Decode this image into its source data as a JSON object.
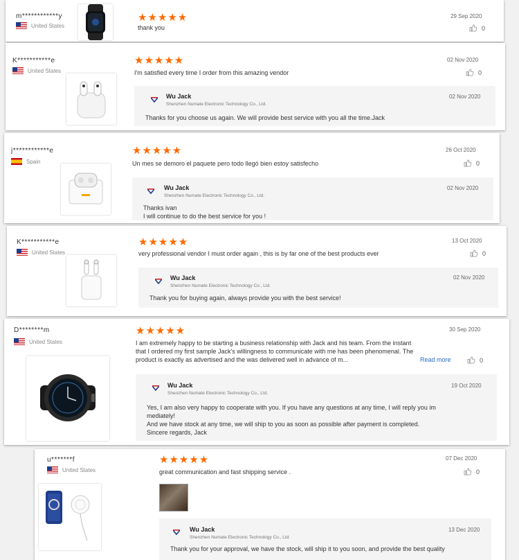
{
  "reviews": [
    {
      "user": "m************y",
      "country": "United States",
      "stars": "★★★★★",
      "date": "29 Sep 2020",
      "text": "thank you",
      "likes": "0",
      "image": "smartwatch-black"
    },
    {
      "user": "K***********e",
      "country": "United States",
      "stars": "★★★★★",
      "date": "02 Nov 2020",
      "text": "I'm satisfied every time I order from this amazing vendor",
      "likes": "0",
      "image": "earbuds-white-case",
      "reply": {
        "name": "Wu Jack",
        "company": "Shenzhen Numate Electronic Technology Co., Ltd.",
        "date": "02 Nov 2020",
        "text": "Thanks for you choose us again. We will provide best service with you all the time.Jack"
      }
    },
    {
      "user": "j************e",
      "country": "Spain",
      "stars": "★★★★★",
      "date": "26 Oct 2020",
      "text": "Un mes se demoro el paquete pero todo llegó bien estoy satisfecho",
      "likes": "0",
      "image": "earbuds-case-box",
      "reply": {
        "name": "Wu Jack",
        "company": "Shenzhen Numate Electronic Technology Co., Ltd.",
        "date": "02 Nov 2020",
        "text_line1": "Thanks ivan",
        "text_line2": "I will continue to do the best service for you !"
      }
    },
    {
      "user": "K***********e",
      "country": "United States",
      "stars": "★★★★★",
      "date": "13 Oct 2020",
      "text": "very professional vendor I must order again , this is by far one of the best products ever",
      "likes": "0",
      "image": "earbuds-open-case",
      "reply": {
        "name": "Wu Jack",
        "company": "Shenzhen Numate Electronic Technology Co., Ltd.",
        "date": "02 Nov 2020",
        "text": "Thank you for buying again, always provide you with the best service!"
      }
    },
    {
      "user": "D********m",
      "country": "United States",
      "stars": "★★★★★",
      "date": "30 Sep 2020",
      "text_line1": "I am extremely happy to be starting a business relationship with Jack and his team.  From the instant",
      "text_line2": "that I ordered my first sample Jack's willingness to communicate with me has been phenomenal.  The",
      "text_line3": "product is exactly as advertised and the was delivered well in advance of m...",
      "read_more": "Read more",
      "likes": "0",
      "image": "smartwatch-round",
      "reply": {
        "name": "Wu Jack",
        "company": "Shenzhen Numate Electronic Technology Co., Ltd.",
        "date": "19 Oct 2020",
        "text_line1": "Yes, I am also very happy to cooperate with you. If you have any questions at any time, I will reply you im",
        "text_line2": "mediately!",
        "text_line3": "And we have stock at any time, we will ship to you as soon as possible after payment is completed.",
        "text_line4": "Sincere regards, Jack"
      }
    },
    {
      "user": "u*******f",
      "country": "United States",
      "stars": "★★★★★",
      "date": "07 Dec 2020",
      "text": "great communication and fast shipping service .",
      "likes": "0",
      "image": "phone-wireless-charger",
      "reply": {
        "name": "Wu Jack",
        "company": "Shenzhen Numate Electronic Technology Co., Ltd.",
        "date": "13 Dec 2020",
        "text": "Thank you for your approval, we have the stock, will ship it to you soon, and provide the best quality"
      }
    }
  ],
  "colors": {
    "star": "#ff6a00",
    "link": "#2a6acb",
    "reply_bg": "#f4f4f4"
  }
}
